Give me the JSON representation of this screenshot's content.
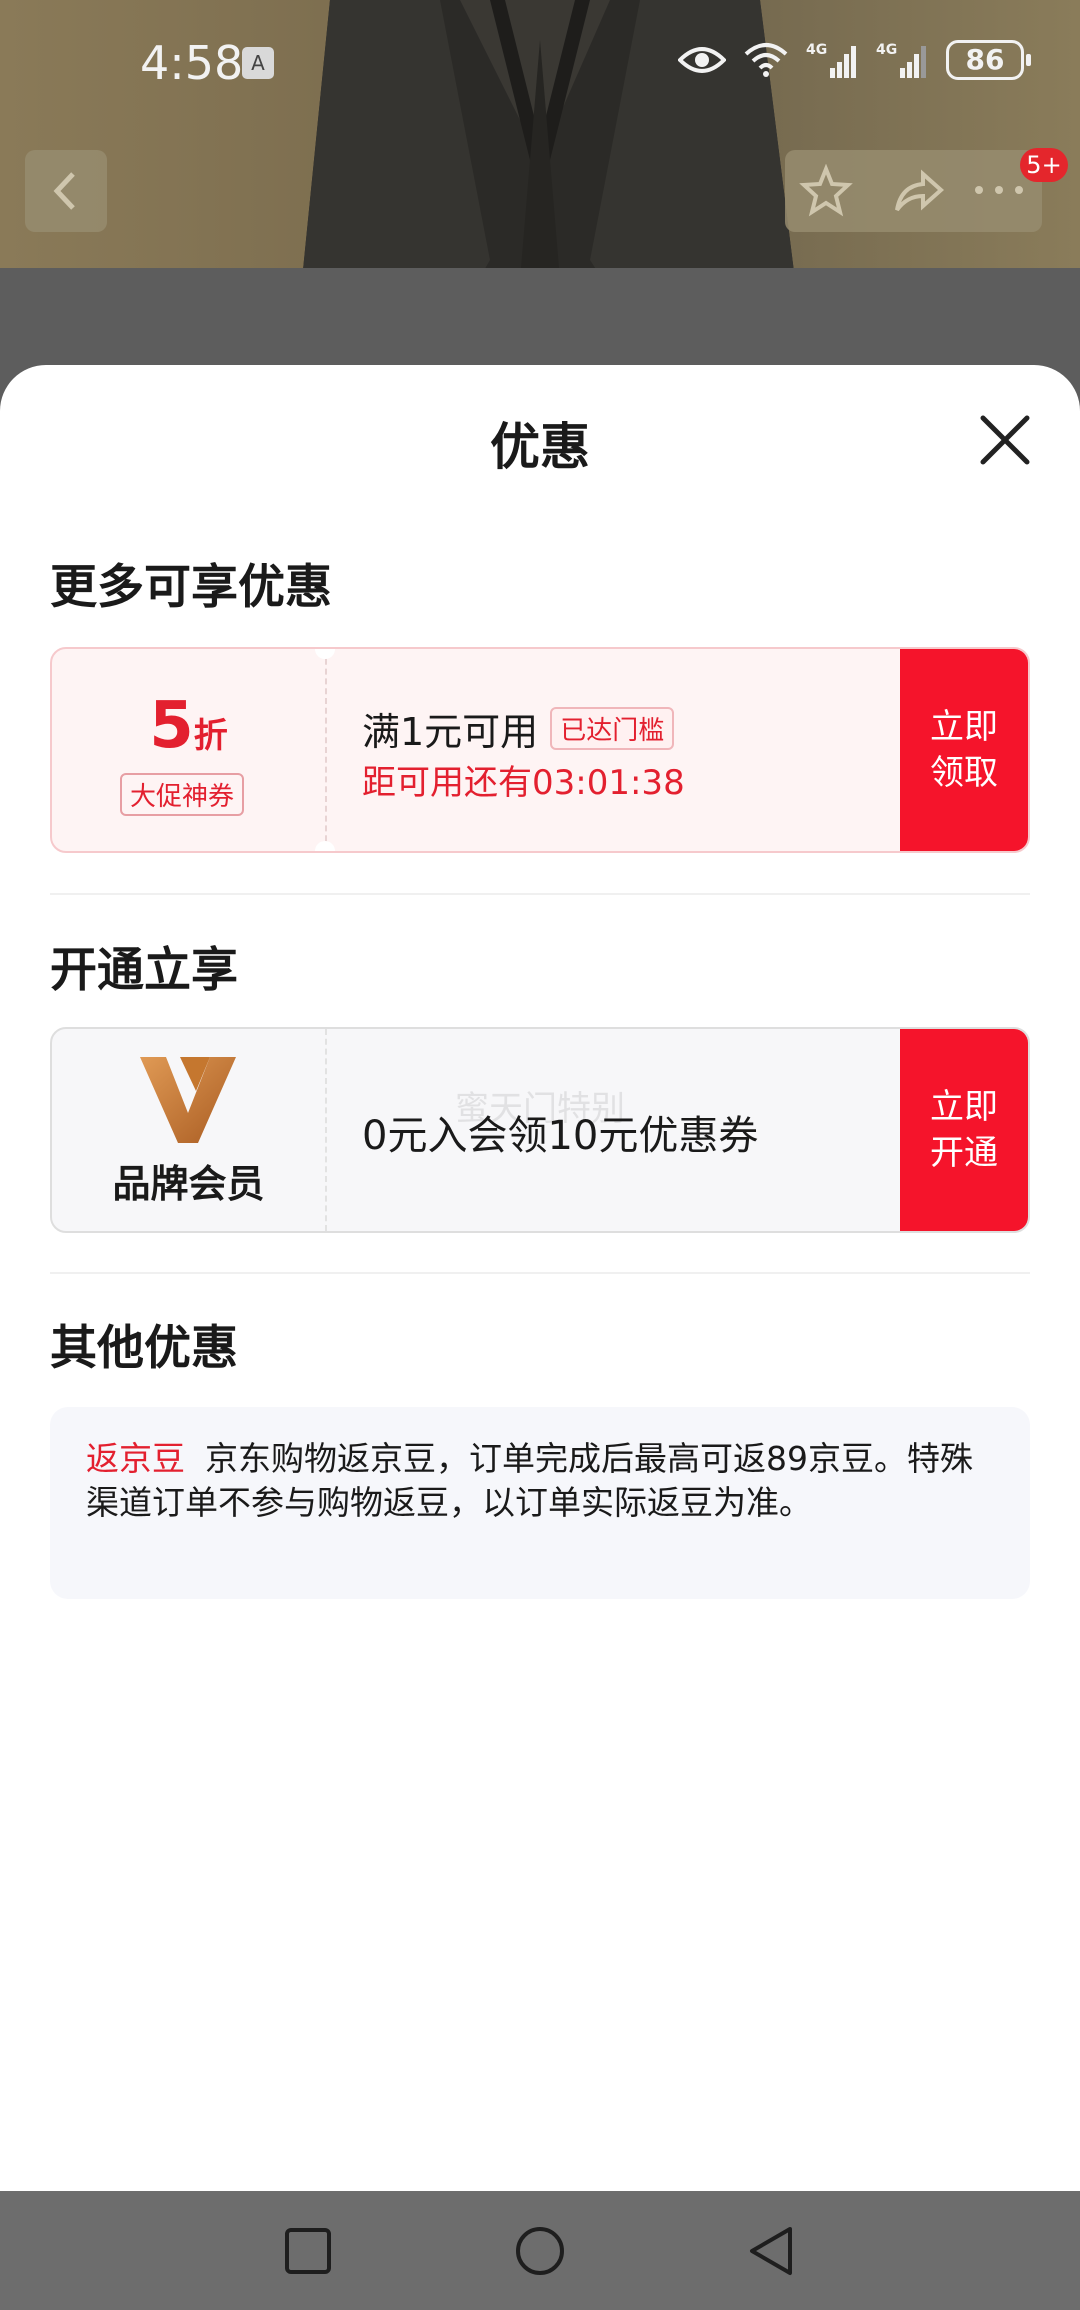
{
  "status_bar": {
    "time": "4:58",
    "ime_badge": "A",
    "battery": "86",
    "network_1": "4G",
    "network_2": "4G"
  },
  "background": {
    "notification_count": "5+"
  },
  "sheet": {
    "title": "优惠",
    "section_more": {
      "title": "更多可享优惠",
      "coupon": {
        "discount_value": "5",
        "discount_unit": "折",
        "tag": "大促神券",
        "condition": "满1元可用",
        "status_tag": "已达门槛",
        "countdown": "距可用还有03:01:38",
        "action": [
          "立即",
          "领取"
        ]
      }
    },
    "section_member": {
      "title": "开通立享",
      "coupon": {
        "brand_label": "品牌会员",
        "offer": "0元入会领10元优惠券",
        "watermark": "蜜天门特别",
        "action": [
          "立即",
          "开通"
        ]
      }
    },
    "section_other": {
      "title": "其他优惠",
      "tag": "返京豆",
      "text": "京东购物返京豆，订单完成后最高可返89京豆。特殊渠道订单不参与购物返豆，以订单实际返豆为准。"
    }
  },
  "colors": {
    "accent": "#f5142b",
    "promo_text": "#e3202f",
    "brand_gold": "#c87a3a"
  }
}
